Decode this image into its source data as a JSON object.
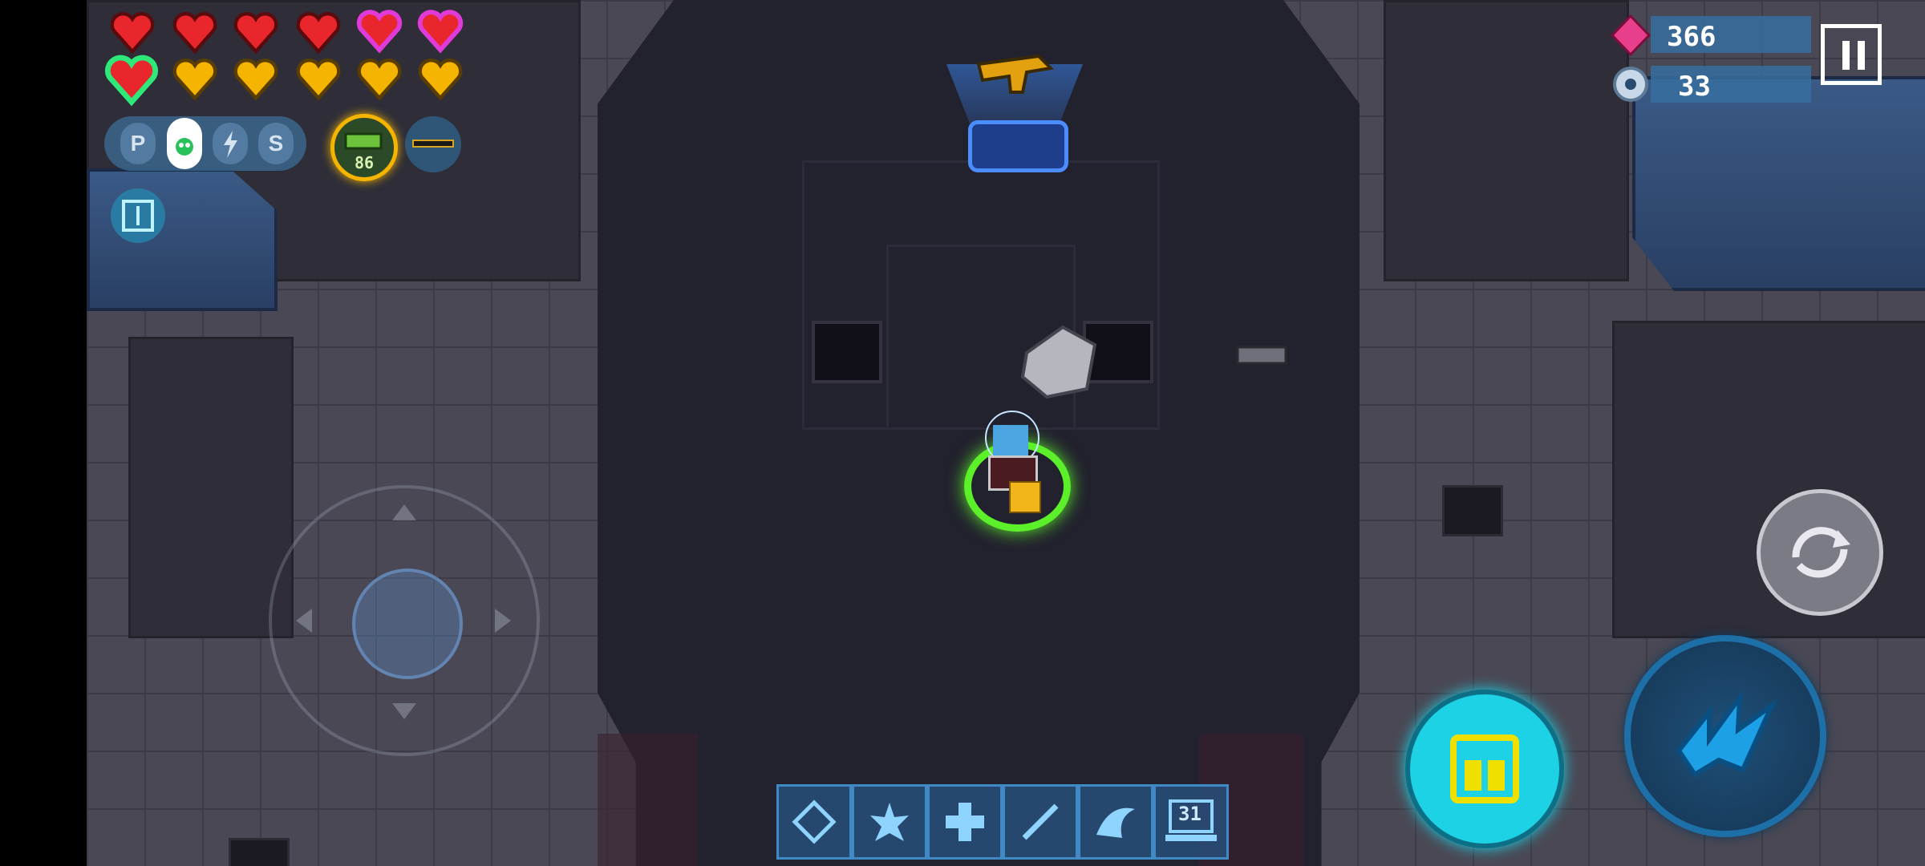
{
  "hud": {
    "gems": {
      "value": "366",
      "icon": "pink-gem-icon",
      "color": "#e83e8c"
    },
    "parts": {
      "value": "33",
      "icon": "gear-part-icon"
    },
    "pause_icon": "pause-icon",
    "hearts": {
      "row1": [
        "red",
        "red",
        "red",
        "red",
        "magenta",
        "magenta"
      ],
      "row2": [
        "red-green-outline",
        "orange",
        "orange",
        "orange",
        "orange",
        "orange"
      ]
    },
    "ammo_types": [
      {
        "label": "P",
        "selected": false
      },
      {
        "label": "",
        "selected": true,
        "icon": "skull-bullet-icon"
      },
      {
        "label": "",
        "selected": false,
        "icon": "lightning-bullet-icon"
      },
      {
        "label": "S",
        "selected": false
      }
    ],
    "active_weapon": {
      "badge": "86",
      "icon": "plasma-cannon-icon"
    },
    "secondary_weapon_icon": "shotgun-icon",
    "left_action_icon": "anchor-portal-icon"
  },
  "skills": [
    {
      "icon": "shield-burst-icon"
    },
    {
      "icon": "explosion-icon"
    },
    {
      "icon": "medkit-cross-icon"
    },
    {
      "icon": "sword-slash-icon"
    },
    {
      "icon": "wave-icon"
    },
    {
      "icon": "laptop-timer-icon",
      "counter": "31"
    }
  ],
  "controls": {
    "joystick": "virtual-joystick",
    "swap_weapon_icon": "swap-weapon-icon",
    "special_skill_icon": "gift-skill-icon",
    "fire_icon": "claw-attack-icon"
  },
  "colors": {
    "accent_cyan": "#1ed2e6",
    "heart_red": "#e8262c",
    "heart_magenta": "#e03ad8",
    "heart_orange": "#f5b400",
    "aura_green": "#5cf02a"
  }
}
